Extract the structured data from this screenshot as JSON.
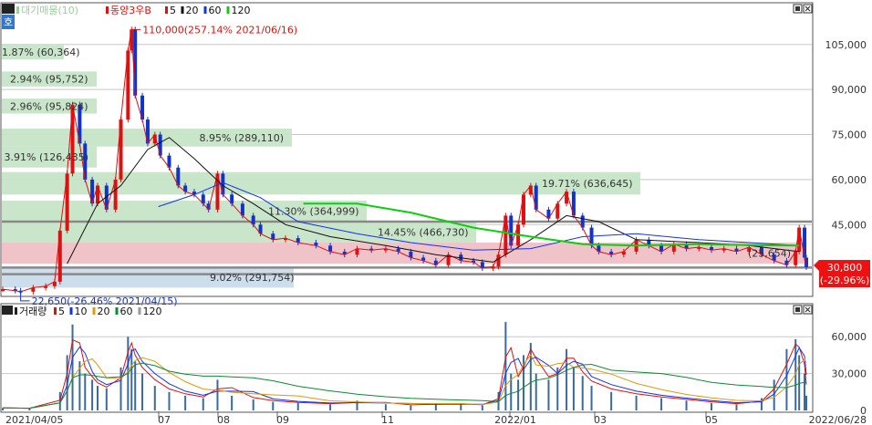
{
  "legend": {
    "top": [
      {
        "label": "대기매물(10)",
        "color": "#9ccf9c"
      },
      {
        "label": "동양3우B",
        "color": "#dd1111"
      },
      {
        "label": "5",
        "color": "#dd1111"
      },
      {
        "label": "20",
        "color": "#111111"
      },
      {
        "label": "60",
        "color": "#1133ee"
      },
      {
        "label": "120",
        "color": "#11cc11"
      }
    ],
    "bottom": [
      {
        "label": "거래량",
        "color": "#222222"
      },
      {
        "label": "5",
        "color": "#dd1111"
      },
      {
        "label": "10",
        "color": "#1133ee"
      },
      {
        "label": "20",
        "color": "#dd9911"
      },
      {
        "label": "60",
        "color": "#118833"
      },
      {
        "label": "120",
        "color": "#999999"
      }
    ],
    "side_tab": "호"
  },
  "colors": {
    "up": "#dd1111",
    "down": "#1133cc",
    "overhang_band": "#c7e5c7",
    "current_band": "#efc0c6",
    "low_band": "#c9dbea",
    "price_box": "#ee1111"
  },
  "chart_data": [
    {
      "type": "candlestick",
      "title": "동양3우B",
      "y_ticks": [
        "105,000",
        "90,000",
        "75,000",
        "60,000",
        "45,000"
      ],
      "yaxis_values": [
        105000,
        90000,
        75000,
        60000,
        45000
      ],
      "ylim": [
        22000,
        118000
      ],
      "x_ticks": [
        "2021/04/05",
        "07",
        "08",
        "09",
        "11",
        "2022/01",
        "03",
        "05",
        "2022/06/28"
      ],
      "x_range": [
        "2021/04/05",
        "2022/06/28"
      ],
      "moving_averages": [
        5,
        20,
        60,
        120
      ],
      "price_series": [
        [
          "2021/04/05",
          23500
        ],
        [
          "2021/04/12",
          23000
        ],
        [
          "2021/04/15",
          22650
        ],
        [
          "2021/04/22",
          24000
        ],
        [
          "2021/04/29",
          24500
        ],
        [
          "2021/05/04",
          26000
        ],
        [
          "2021/05/07",
          43000
        ],
        [
          "2021/05/11",
          62000
        ],
        [
          "2021/05/14",
          85000
        ],
        [
          "2021/05/18",
          72000
        ],
        [
          "2021/05/21",
          60000
        ],
        [
          "2021/05/25",
          52000
        ],
        [
          "2021/05/28",
          58000
        ],
        [
          "2021/06/02",
          50000
        ],
        [
          "2021/06/07",
          60000
        ],
        [
          "2021/06/10",
          80000
        ],
        [
          "2021/06/14",
          103000
        ],
        [
          "2021/06/16",
          110000
        ],
        [
          "2021/06/18",
          88000
        ],
        [
          "2021/06/22",
          80000
        ],
        [
          "2021/06/25",
          72000
        ],
        [
          "2021/06/29",
          75000
        ],
        [
          "2021/07/02",
          68000
        ],
        [
          "2021/07/07",
          64000
        ],
        [
          "2021/07/12",
          58000
        ],
        [
          "2021/07/16",
          56000
        ],
        [
          "2021/07/21",
          55000
        ],
        [
          "2021/07/26",
          52000
        ],
        [
          "2021/07/29",
          50000
        ],
        [
          "2021/08/03",
          62000
        ],
        [
          "2021/08/06",
          55000
        ],
        [
          "2021/08/11",
          52000
        ],
        [
          "2021/08/17",
          48000
        ],
        [
          "2021/08/23",
          45000
        ],
        [
          "2021/08/27",
          42000
        ],
        [
          "2021/09/03",
          40000
        ],
        [
          "2021/09/10",
          40500
        ],
        [
          "2021/09/17",
          39000
        ],
        [
          "2021/09/27",
          38000
        ],
        [
          "2021/10/05",
          36000
        ],
        [
          "2021/10/13",
          35000
        ],
        [
          "2021/10/20",
          37000
        ],
        [
          "2021/10/28",
          36500
        ],
        [
          "2021/11/05",
          37000
        ],
        [
          "2021/11/12",
          36000
        ],
        [
          "2021/11/19",
          34000
        ],
        [
          "2021/11/26",
          33000
        ],
        [
          "2021/12/03",
          31500
        ],
        [
          "2021/12/10",
          35000
        ],
        [
          "2021/12/17",
          33000
        ],
        [
          "2021/12/24",
          32500
        ],
        [
          "2021/12/29",
          30500
        ],
        [
          "2022/01/04",
          31000
        ],
        [
          "2022/01/07",
          35000
        ],
        [
          "2022/01/11",
          48000
        ],
        [
          "2022/01/14",
          38000
        ],
        [
          "2022/01/18",
          45000
        ],
        [
          "2022/01/21",
          55000
        ],
        [
          "2022/01/25",
          58000
        ],
        [
          "2022/01/28",
          50000
        ],
        [
          "2022/02/04",
          47000
        ],
        [
          "2022/02/09",
          52000
        ],
        [
          "2022/02/14",
          56000
        ],
        [
          "2022/02/18",
          48000
        ],
        [
          "2022/02/23",
          44000
        ],
        [
          "2022/02/28",
          38000
        ],
        [
          "2022/03/04",
          36000
        ],
        [
          "2022/03/11",
          35000
        ],
        [
          "2022/03/18",
          36000
        ],
        [
          "2022/03/25",
          40000
        ],
        [
          "2022/04/01",
          38000
        ],
        [
          "2022/04/08",
          36000
        ],
        [
          "2022/04/15",
          38500
        ],
        [
          "2022/04/22",
          37000
        ],
        [
          "2022/04/29",
          37500
        ],
        [
          "2022/05/06",
          36500
        ],
        [
          "2022/05/13",
          37000
        ],
        [
          "2022/05/20",
          36000
        ],
        [
          "2022/05/27",
          37500
        ],
        [
          "2022/06/03",
          35000
        ],
        [
          "2022/06/10",
          33000
        ],
        [
          "2022/06/17",
          31500
        ],
        [
          "2022/06/22",
          36000
        ],
        [
          "2022/06/24",
          44000
        ],
        [
          "2022/06/27",
          34000
        ],
        [
          "2022/06/28",
          30800
        ]
      ],
      "ma20_series": [
        [
          "2021/05/11",
          32000
        ],
        [
          "2021/05/28",
          52000
        ],
        [
          "2021/06/10",
          58000
        ],
        [
          "2021/06/25",
          70000
        ],
        [
          "2021/07/07",
          74000
        ],
        [
          "2021/07/21",
          67000
        ],
        [
          "2021/08/06",
          58000
        ],
        [
          "2021/08/23",
          52000
        ],
        [
          "2021/09/10",
          45000
        ],
        [
          "2021/10/05",
          41000
        ],
        [
          "2021/11/05",
          38000
        ],
        [
          "2021/12/03",
          35000
        ],
        [
          "2022/01/04",
          32500
        ],
        [
          "2022/01/25",
          40000
        ],
        [
          "2022/02/14",
          48000
        ],
        [
          "2022/03/04",
          46000
        ],
        [
          "2022/03/25",
          40000
        ],
        [
          "2022/04/29",
          39000
        ],
        [
          "2022/05/27",
          38000
        ],
        [
          "2022/06/24",
          36000
        ]
      ],
      "ma60_series": [
        [
          "2021/07/01",
          51000
        ],
        [
          "2021/07/21",
          55000
        ],
        [
          "2021/08/06",
          59000
        ],
        [
          "2021/08/27",
          54000
        ],
        [
          "2021/09/17",
          46000
        ],
        [
          "2021/10/20",
          42000
        ],
        [
          "2021/11/19",
          39000
        ],
        [
          "2021/12/24",
          36500
        ],
        [
          "2022/01/25",
          37000
        ],
        [
          "2022/02/23",
          41000
        ],
        [
          "2022/03/25",
          42000
        ],
        [
          "2022/04/29",
          40000
        ],
        [
          "2022/05/27",
          39000
        ],
        [
          "2022/06/24",
          38000
        ]
      ],
      "ma120_series": [
        [
          "2021/09/20",
          52000
        ],
        [
          "2021/10/20",
          52000
        ],
        [
          "2021/11/19",
          49000
        ],
        [
          "2021/12/24",
          44000
        ],
        [
          "2022/01/25",
          41000
        ],
        [
          "2022/02/23",
          38500
        ],
        [
          "2022/03/25",
          38000
        ],
        [
          "2022/04/29",
          38500
        ],
        [
          "2022/05/27",
          38200
        ],
        [
          "2022/06/24",
          38000
        ]
      ],
      "overhang_bands": [
        {
          "label": "1.87% (60,364)",
          "price_from": 100000,
          "price_to": 105000
        },
        {
          "label": "2.94% (95,752)",
          "price_from": 91000,
          "price_to": 96000
        },
        {
          "label": "2.96% (95,824)",
          "price_from": 82000,
          "price_to": 87000
        },
        {
          "label": "8.95% (289,110)",
          "price_from": 71000,
          "price_to": 77000
        },
        {
          "label": "3.91% (126,435)",
          "price_from": 64000,
          "price_to": 71000
        },
        {
          "label": "19.71% (636,645)",
          "price_from": 55000,
          "price_to": 62500
        },
        {
          "label": "11.30% (364,999)",
          "price_from": 46000,
          "price_to": 53000
        },
        {
          "label": "14.45% (466,730)",
          "price_from": 39000,
          "price_to": 46000
        },
        {
          "label": "(25,654)",
          "price_from": 32000,
          "price_to": 39000
        },
        {
          "label": "9.02% (291,754)",
          "price_from": 24000,
          "price_to": 31000
        }
      ],
      "horizontal_lines": [
        46000,
        30700,
        28500
      ],
      "annotations": [
        {
          "label": "110,000(257.14% 2021/06/16)",
          "date": "2021/06/16",
          "price": 110000
        },
        {
          "label": "22,650(-26.46% 2021/04/15)",
          "date": "2021/04/15",
          "price": 22650
        }
      ],
      "current_price": "30,800",
      "current_change": "(-29.96%)",
      "current_value": 30800
    },
    {
      "type": "bar",
      "title": "거래량",
      "y_ticks": [
        "60,000",
        "30,000",
        "0"
      ],
      "yaxis_values": [
        60000,
        30000,
        0
      ],
      "ylim": [
        0,
        78000
      ],
      "moving_averages": [
        5,
        10,
        20,
        60,
        120
      ],
      "volume_series": [
        [
          "2021/04/05",
          2000
        ],
        [
          "2021/04/20",
          1500
        ],
        [
          "2021/05/07",
          15000
        ],
        [
          "2021/05/11",
          45000
        ],
        [
          "2021/05/14",
          70000
        ],
        [
          "2021/05/18",
          40000
        ],
        [
          "2021/05/21",
          30000
        ],
        [
          "2021/05/25",
          25000
        ],
        [
          "2021/05/28",
          20000
        ],
        [
          "2021/06/02",
          18000
        ],
        [
          "2021/06/10",
          35000
        ],
        [
          "2021/06/14",
          60000
        ],
        [
          "2021/06/16",
          50000
        ],
        [
          "2021/06/18",
          40000
        ],
        [
          "2021/06/22",
          30000
        ],
        [
          "2021/06/29",
          20000
        ],
        [
          "2021/07/07",
          15000
        ],
        [
          "2021/07/16",
          12000
        ],
        [
          "2021/07/26",
          10000
        ],
        [
          "2021/08/03",
          25000
        ],
        [
          "2021/08/11",
          12000
        ],
        [
          "2021/08/23",
          9000
        ],
        [
          "2021/09/03",
          7000
        ],
        [
          "2021/09/17",
          6000
        ],
        [
          "2021/10/05",
          5000
        ],
        [
          "2021/10/20",
          8000
        ],
        [
          "2021/11/05",
          5000
        ],
        [
          "2021/11/19",
          4000
        ],
        [
          "2021/12/03",
          6000
        ],
        [
          "2021/12/17",
          5000
        ],
        [
          "2021/12/29",
          4000
        ],
        [
          "2022/01/07",
          15000
        ],
        [
          "2022/01/11",
          72000
        ],
        [
          "2022/01/14",
          30000
        ],
        [
          "2022/01/18",
          25000
        ],
        [
          "2022/01/21",
          45000
        ],
        [
          "2022/01/25",
          55000
        ],
        [
          "2022/01/28",
          30000
        ],
        [
          "2022/02/04",
          25000
        ],
        [
          "2022/02/09",
          35000
        ],
        [
          "2022/02/14",
          50000
        ],
        [
          "2022/02/18",
          35000
        ],
        [
          "2022/02/23",
          28000
        ],
        [
          "2022/02/28",
          20000
        ],
        [
          "2022/03/11",
          15000
        ],
        [
          "2022/03/25",
          12000
        ],
        [
          "2022/04/08",
          10000
        ],
        [
          "2022/04/22",
          8000
        ],
        [
          "2022/05/06",
          6000
        ],
        [
          "2022/05/20",
          5000
        ],
        [
          "2022/06/03",
          10000
        ],
        [
          "2022/06/10",
          25000
        ],
        [
          "2022/06/17",
          50000
        ],
        [
          "2022/06/22",
          58000
        ],
        [
          "2022/06/24",
          45000
        ],
        [
          "2022/06/27",
          30000
        ],
        [
          "2022/06/28",
          12000
        ]
      ]
    }
  ]
}
